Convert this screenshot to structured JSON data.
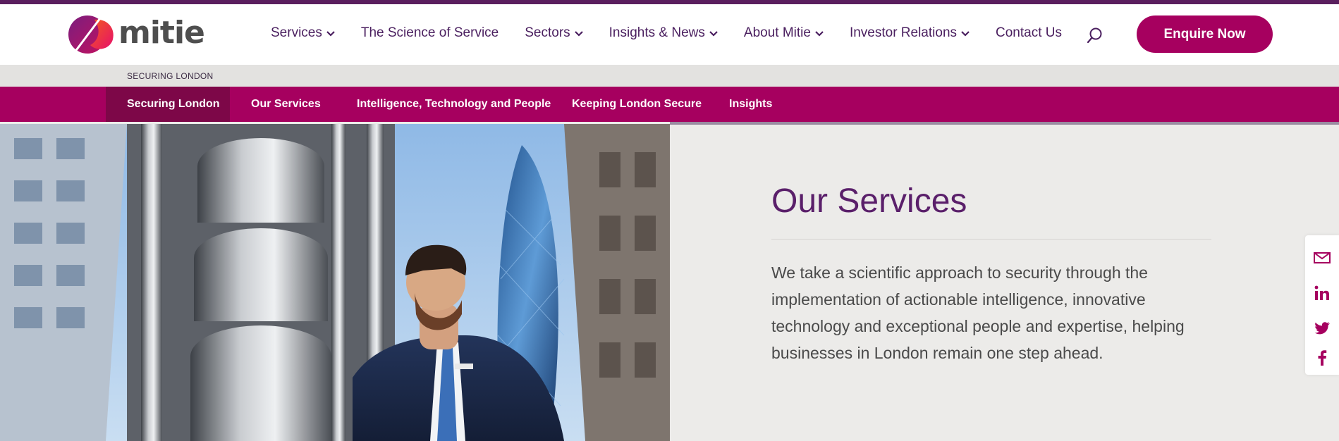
{
  "brand": {
    "logo_text": "mitie",
    "accent": "#a6005f",
    "nav_color": "#4a1f5f",
    "topbar": "#5a1f5e"
  },
  "nav": {
    "items": [
      {
        "label": "Services",
        "dropdown": true
      },
      {
        "label": "The Science of Service",
        "dropdown": false
      },
      {
        "label": "Sectors",
        "dropdown": true
      },
      {
        "label": "Insights & News",
        "dropdown": true
      },
      {
        "label": "About Mitie",
        "dropdown": true
      },
      {
        "label": "Investor Relations",
        "dropdown": true
      },
      {
        "label": "Contact Us",
        "dropdown": false
      }
    ],
    "search_icon": "search-icon",
    "cta_label": "Enquire Now"
  },
  "breadcrumb": {
    "label": "SECURING LONDON"
  },
  "subnav": {
    "items": [
      {
        "label": "Securing London",
        "active": true
      },
      {
        "label": "Our Services",
        "active": false
      },
      {
        "label": "Intelligence, Technology and People",
        "active": false
      },
      {
        "label": "Keeping London Secure",
        "active": false
      },
      {
        "label": "Insights",
        "active": false
      }
    ]
  },
  "main": {
    "title": "Our Services",
    "description": "We take a scientific approach to security through the implementation of actionable intelligence, innovative technology and exceptional people and expertise, helping businesses in London remain one step ahead."
  },
  "social": {
    "icons": [
      "email-icon",
      "linkedin-icon",
      "twitter-icon",
      "facebook-icon"
    ]
  }
}
